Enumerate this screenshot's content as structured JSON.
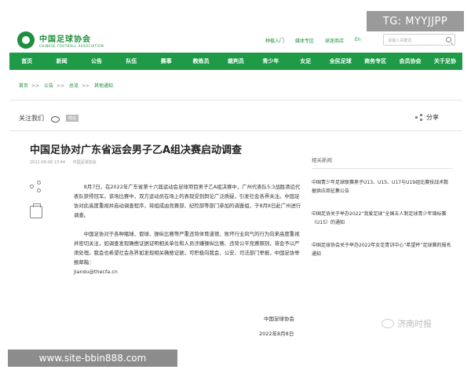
{
  "watermarks": {
    "tg": "TG: MYYJJPP",
    "site": "www.site-bbin888.com",
    "newspaper": "济南时报"
  },
  "header": {
    "logo_cn": "中国足球协会",
    "logo_en": "CHINESE FOOTBALL ASSOCIATION",
    "toplinks": [
      "种植入门",
      "媒体专区",
      "球迷商店",
      "En"
    ],
    "search_placeholder": "请输入关键词"
  },
  "nav": [
    "首页",
    "新闻",
    "公告",
    "队伍",
    "赛事",
    "教练员",
    "裁判员",
    "青少年",
    "女足",
    "全民足球",
    "商务专区",
    "会员协会",
    "关于足协"
  ],
  "breadcrumb": [
    "首页",
    "公告",
    "总览",
    "其他通知"
  ],
  "share": {
    "follow_label": "关注我们",
    "weixin_badge": "微信",
    "share_label": "分享"
  },
  "article": {
    "title": "中国足协对广东省运会男子乙A组决赛启动调查",
    "date": "2022-08-08 13:44",
    "source": "中国足球协会",
    "paragraphs": [
      "8月7日，在2022年广东省第十六届运动会足球项目男子乙A组决赛中，广州代表队5:3战胜清远代表队获得冠军。该场比赛中，双方运动员在场上的表现受到舆论广泛质疑，引发社会各界关注。中国足协对此高度重视并启动调查程序，将组成由竞赛部、纪检部等部门参加的调查组，于8月8日赴广州进行调查。",
      "中国足协对于各种赌球、假球、操纵比赛等严重违背体育道德、败坏行业风气的行为向来高度重视并密切关注，如调查发现确凿证据证明相关单位和人员涉嫌操纵比赛、违背公平竞赛原则，将会予以严肃处理。我会也希望社会各界如发现相关确凿证据，可积极向我会、公安、司法部门举报，中国足协举报邮箱："
    ],
    "email": "jiandu@thecfa.cn",
    "sign_org": "中国足球协会",
    "sign_date": "2022年8月8日"
  },
  "related": {
    "heading": "相关新闻",
    "items": [
      "中国青少年足球联赛男子U13、U15、U17与U19组比赛技战术数据供应商征集公告",
      "中国足协关于举办2022“我爱足球”全国五人制足球青少年锦标赛（U15）的通知",
      "中国足球协会关于举办2022年女足青训中心“希望杯”足球赛的报名通知"
    ]
  }
}
